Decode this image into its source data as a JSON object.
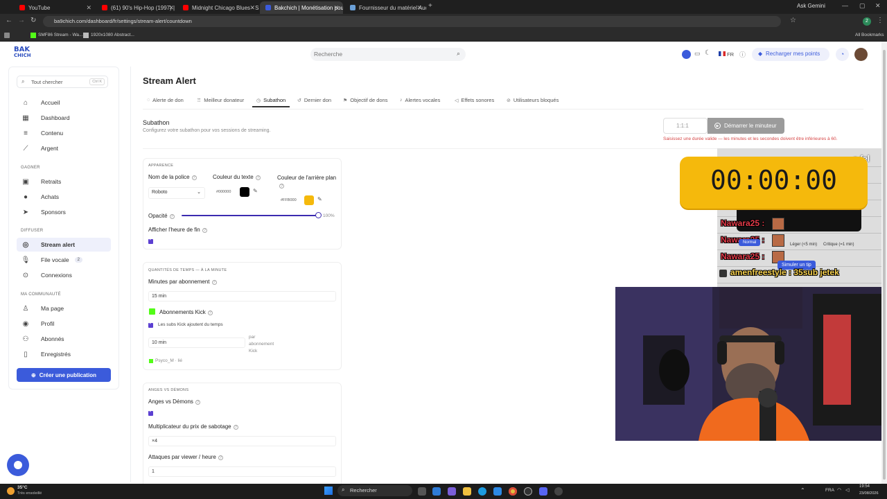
{
  "browser": {
    "tabs": [
      {
        "label": "YouTube",
        "color": "#ff0000"
      },
      {
        "label": "(61) 90's Hip-Hop (1997) |",
        "color": "#ff0000"
      },
      {
        "label": "Midnight Chicago Blues - Slow",
        "color": "#ff0000"
      },
      {
        "label": "Bakchich | Monétisation pour le",
        "color": "#3b5bdb"
      },
      {
        "label": "Fournisseur du matériel Audiovi",
        "color": "#6aa0d8"
      }
    ],
    "url": "ba9chich.com/dashboard/fr/settings/stream-alert/countdown",
    "ask_gemini": "Ask Gemini",
    "bookmarks": [
      "SMF86 Stream - Wa...",
      "1920x1080 Abstract..."
    ],
    "all_bookmarks": "All Bookmarks",
    "profile_initial": "2"
  },
  "header": {
    "logo_line1": "BAK",
    "logo_line2": "CHICH",
    "search_placeholder": "Recherche",
    "lang": "FR",
    "recharge_label": "Recharger mes points"
  },
  "sidebar": {
    "search_placeholder": "Tout chercher",
    "search_shortcut": "Ctrl K",
    "main_items": [
      {
        "label": "Accueil",
        "icon": "home-icon"
      },
      {
        "label": "Dashboard",
        "icon": "dashboard-icon"
      },
      {
        "label": "Contenu",
        "icon": "list-icon"
      },
      {
        "label": "Argent",
        "icon": "chart-icon"
      }
    ],
    "section_gagner": "GAGNER",
    "gagner_items": [
      {
        "label": "Retraits",
        "icon": "wallet-icon"
      },
      {
        "label": "Achats",
        "icon": "cart-icon"
      },
      {
        "label": "Sponsors",
        "icon": "send-icon"
      }
    ],
    "section_diffuser": "DIFFUSER",
    "diffuser_items": [
      {
        "label": "Stream alert",
        "icon": "broadcast-icon"
      },
      {
        "label": "File vocale",
        "icon": "mic-icon",
        "badge": "2"
      },
      {
        "label": "Connexions",
        "icon": "link-icon"
      }
    ],
    "section_communaute": "MA COMMUNAUTÉ",
    "communaute_items": [
      {
        "label": "Ma page",
        "icon": "user-icon"
      },
      {
        "label": "Profil",
        "icon": "profile-icon"
      },
      {
        "label": "Abonnés",
        "icon": "users-icon"
      },
      {
        "label": "Enregistrés",
        "icon": "bookmark-icon"
      }
    ],
    "publish_label": "Créer une publication"
  },
  "main": {
    "title": "Stream Alert",
    "tabs": [
      "Alerte de don",
      "Meilleur donateur",
      "Subathon",
      "Dernier don",
      "Objectif de dons",
      "Alertes vocales",
      "Effets sonores",
      "Utilisateurs bloqués"
    ],
    "section_title": "Subathon",
    "section_desc": "Configurez votre subathon pour vos sessions de streaming.",
    "timer_input_value": "1:1:1",
    "start_button": "Démarrer le minuteur",
    "error_message": "Saisissez une durée valide — les minutes et les secondes doivent être inférieures à 60.",
    "appearance": {
      "header": "APPARENCE",
      "font_label": "Nom de la police",
      "font_value": "Roboto",
      "text_color_label": "Couleur du texte",
      "text_color_value": "#000000",
      "text_color": "#000000",
      "bg_color_label": "Couleur de l'arrière plan",
      "bg_color_value": "#FFB000",
      "bg_color": "#f5b90c",
      "opacity_label": "Opacité",
      "opacity_value": "100%",
      "opacity_fraction": 1.0,
      "show_end_label": "Afficher l'heure de fin"
    },
    "time": {
      "header": "QUANTITÉS DE TEMPS — À LA MINUTE",
      "minutes_per_sub_label": "Minutes par abonnement",
      "minutes_per_sub_value": "15 min",
      "kick_label": "Abonnements Kick",
      "kick_checkbox_label": "Les subs Kick ajoutent du temps",
      "kick_minutes_value": "10 min",
      "kick_suffix_1": "par",
      "kick_suffix_2": "abonnement",
      "kick_suffix_3": "Kick",
      "kick_account": "Psyco_M · lié"
    },
    "angels": {
      "header": "ANGES VS DÉMONS",
      "toggle_label": "Anges vs Démons",
      "multiplier_label": "Multiplicateur du prix de sabotage",
      "multiplier_value": "×4",
      "attacks_label": "Attaques par viewer / heure",
      "attacks_value": "1"
    }
  },
  "overlay": {
    "timer": "00:00:00",
    "partial_text": "s fel",
    "chat": [
      {
        "name": "Nawara25 :"
      },
      {
        "name": "Nawara25 :"
      },
      {
        "name": "Nawara25 :"
      }
    ],
    "last_chat": "amenfreestyle : 35sub jetek",
    "btn_normal": "Normal",
    "opt_leger": "Léger (<5 min)",
    "opt_critique": "Critique (=1 min)",
    "btn_simulate": "Simuler un tip"
  },
  "taskbar": {
    "weather_temp": "35°C",
    "weather_desc": "Très ensoleillé",
    "search": "Rechercher",
    "lang": "FRA",
    "time": "19:54",
    "date": "23/08/2026"
  }
}
